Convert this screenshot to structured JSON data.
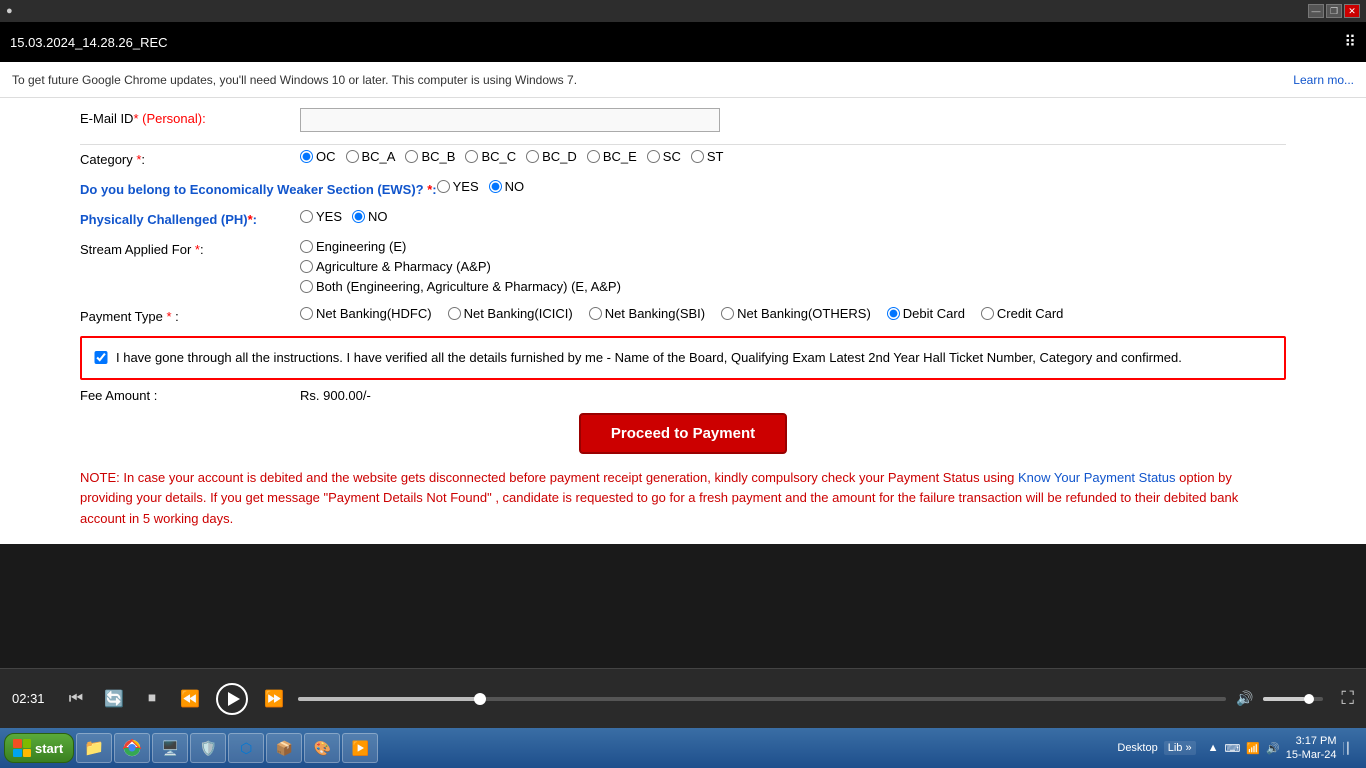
{
  "window": {
    "title": "",
    "recording_label": "15.03.2024_14.28.26_REC",
    "dots_label": "⠿"
  },
  "chrome_notice": {
    "text": "To get future Google Chrome updates, you'll need Windows 10 or later. This computer is using Windows 7.",
    "learn_more": "Learn mo..."
  },
  "form": {
    "email_label": "E-Mail ID",
    "email_req": "* (Personal):",
    "category_label": "Category",
    "category_req": "*:",
    "category_options": [
      "OC",
      "BC_A",
      "BC_B",
      "BC_C",
      "BC_D",
      "BC_E",
      "SC",
      "ST"
    ],
    "ews_label": "Do you belong to Economically Weaker Section (EWS)?",
    "ews_req": "*:",
    "ews_options": [
      "YES",
      "NO"
    ],
    "ews_selected": "NO",
    "ph_label": "Physically Challenged (PH)",
    "ph_req": "*:",
    "ph_options": [
      "YES",
      "NO"
    ],
    "ph_selected": "NO",
    "stream_label": "Stream Applied For",
    "stream_req": "*:",
    "stream_options": [
      "Engineering (E)",
      "Agriculture & Pharmacy (A&P)",
      "Both (Engineering, Agriculture & Pharmacy) (E, A&P)"
    ],
    "payment_label": "Payment Type",
    "payment_req": "*:",
    "payment_options": [
      "Net Banking(HDFC)",
      "Net Banking(ICICI)",
      "Net Banking(SBI)",
      "Net Banking(OTHERS)",
      "Debit Card",
      "Credit Card"
    ],
    "payment_selected": "Debit Card",
    "checkbox_text": "I have gone through all the instructions. I have verified all the details furnished by me - Name of the Board, Qualifying Exam Latest 2nd Year Hall Ticket Number, Category and confirmed.",
    "fee_label": "Fee Amount :",
    "fee_value": "Rs. 900.00/-",
    "proceed_btn": "Proceed to Payment",
    "note_text": "NOTE: In case your account is debited and the website gets disconnected before payment receipt generation, kindly compulsory check your Payment Status using",
    "know_link": "Know Your Payment Status",
    "note_text2": "option by providing your details. If you get message \"Payment Details Not Found\" , candidate is requested to go for a fresh payment and the amount for the failure transaction will be refunded to their debited bank account in 5 working days."
  },
  "media_player": {
    "time": "02:31"
  },
  "taskbar": {
    "start_label": "start",
    "desktop_label": "Desktop",
    "lib_label": "Lib »",
    "time": "3:17 PM",
    "date": "15-Mar-24"
  },
  "title_bar_buttons": {
    "minimize": "—",
    "restore": "❐",
    "close": "✕"
  }
}
